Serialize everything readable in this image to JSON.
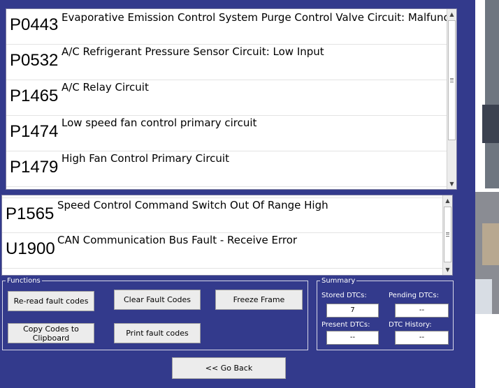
{
  "dtc_list_top": [
    {
      "code": "P0443",
      "description": "Evaporative Emission Control System Purge Control Valve Circuit: Malfunction"
    },
    {
      "code": "P0532",
      "description": "A/C Refrigerant Pressure Sensor Circuit: Low Input"
    },
    {
      "code": "P1465",
      "description": "A/C Relay Circuit"
    },
    {
      "code": "P1474",
      "description": "Low speed fan control primary circuit"
    },
    {
      "code": "P1479",
      "description": "High Fan Control Primary Circuit"
    }
  ],
  "dtc_list_bottom": [
    {
      "code": "P1565",
      "description": "Speed Control Command Switch Out Of Range High"
    },
    {
      "code": "U1900",
      "description": "CAN Communication Bus Fault - Receive Error"
    }
  ],
  "functions": {
    "legend": "Functions",
    "reread_label": "Re-read fault codes",
    "clear_label": "Clear Fault Codes",
    "freeze_label": "Freeze Frame",
    "copy_label": "Copy Codes to Clipboard",
    "print_label": "Print fault codes"
  },
  "summary": {
    "legend": "Summary",
    "stored_label": "Stored DTCs:",
    "stored_value": "7",
    "pending_label": "Pending DTCs:",
    "pending_value": "--",
    "present_label": "Present DTCs:",
    "present_value": "--",
    "history_label": "DTC History:",
    "history_value": "--"
  },
  "go_back_label": "<< Go Back",
  "colors": {
    "window_bg": "#333a8c",
    "list_bg": "#ffffff",
    "button_bg": "#ececec"
  }
}
